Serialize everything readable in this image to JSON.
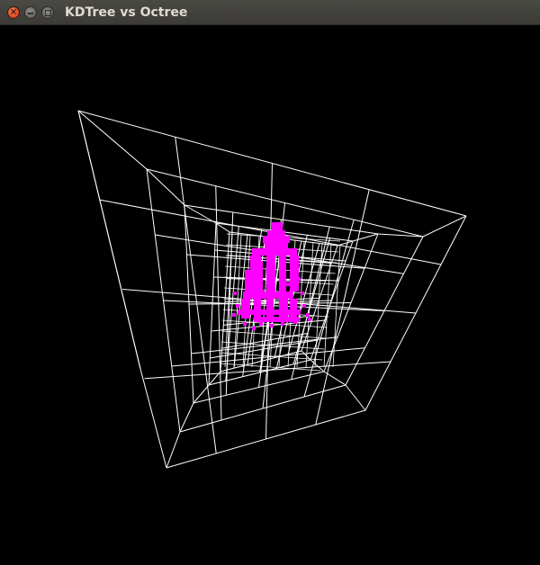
{
  "window": {
    "title": "KDTree vs Octree",
    "buttons": {
      "close_glyph": "×",
      "minimize_icon": "minimize-icon",
      "maximize_icon": "maximize-icon"
    },
    "colors": {
      "titlebar": "#3c3b37",
      "title_text": "#dfdbd2",
      "close_button": "#df4b26"
    }
  },
  "viewport": {
    "background": "#000000",
    "grid_color": "#ffffff",
    "points_color": "#ff00ff"
  }
}
